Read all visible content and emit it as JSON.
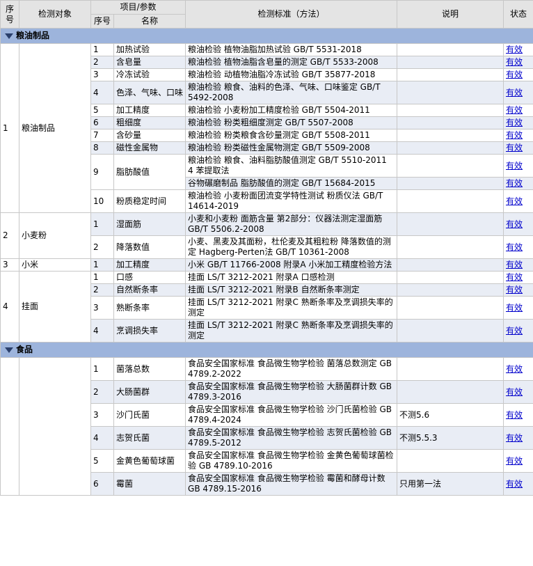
{
  "header": {
    "seq": "序号",
    "object": "检测对象",
    "item_param": "项目/参数",
    "sub_seq": "序号",
    "sub_name": "名称",
    "standard": "检测标准（方法）",
    "note": "说明",
    "status": "状态"
  },
  "categories": [
    {
      "name": "粮油制品",
      "groups": [
        {
          "seq": "1",
          "object": "粮油制品",
          "items": [
            {
              "no": "1",
              "name": "加热试验",
              "standards": [
                "粮油检验 植物油脂加热试验 GB/T 5531-2018"
              ],
              "note": "",
              "status": "有效"
            },
            {
              "no": "2",
              "name": "含皂量",
              "standards": [
                "粮油检验 植物油脂含皂量的测定 GB/T 5533-2008"
              ],
              "note": "",
              "status": "有效"
            },
            {
              "no": "3",
              "name": "冷冻试验",
              "standards": [
                "粮油检验 动植物油脂冷冻试验 GB/T 35877-2018"
              ],
              "note": "",
              "status": "有效"
            },
            {
              "no": "4",
              "name": "色泽、气味、口味",
              "standards": [
                "粮油检验 粮食、油料的色泽、气味、口味鉴定 GB/T 5492-2008"
              ],
              "note": "",
              "status": "有效"
            },
            {
              "no": "5",
              "name": "加工精度",
              "standards": [
                "粮油检验 小麦粉加工精度检验 GB/T 5504-2011"
              ],
              "note": "",
              "status": "有效"
            },
            {
              "no": "6",
              "name": "粗细度",
              "standards": [
                "粮油检验 粉类粗细度测定 GB/T 5507-2008"
              ],
              "note": "",
              "status": "有效"
            },
            {
              "no": "7",
              "name": "含砂量",
              "standards": [
                "粮油检验 粉类粮食含砂量测定 GB/T 5508-2011"
              ],
              "note": "",
              "status": "有效"
            },
            {
              "no": "8",
              "name": "磁性金属物",
              "standards": [
                "粮油检验 粉类磁性金属物测定 GB/T 5509-2008"
              ],
              "note": "",
              "status": "有效"
            },
            {
              "no": "9",
              "name": "脂肪酸值",
              "standards": [
                "粮油检验 粮食、油料脂肪酸值测定 GB/T 5510-2011 4 苯提取法",
                "谷物碾磨制品 脂肪酸值的测定 GB/T 15684-2015"
              ],
              "note": "",
              "status": "有效"
            },
            {
              "no": "10",
              "name": "粉质稳定时间",
              "standards": [
                "粮油检验 小麦粉面团流变学特性测试 粉质仪法 GB/T 14614-2019"
              ],
              "note": "",
              "status": "有效"
            }
          ]
        },
        {
          "seq": "2",
          "object": "小麦粉",
          "items": [
            {
              "no": "1",
              "name": "湿面筋",
              "standards": [
                "小麦和小麦粉 面筋含量 第2部分：仪器法测定湿面筋 GB/T 5506.2-2008"
              ],
              "note": "",
              "status": "有效"
            },
            {
              "no": "2",
              "name": "降落数值",
              "standards": [
                "小麦、黑麦及其面粉，杜伦麦及其粗粒粉 降落数值的测定 Hagberg-Perten法 GB/T 10361-2008"
              ],
              "note": "",
              "status": "有效"
            }
          ]
        },
        {
          "seq": "3",
          "object": "小米",
          "items": [
            {
              "no": "1",
              "name": "加工精度",
              "standards": [
                "小米 GB/T 11766-2008 附录A 小米加工精度检验方法"
              ],
              "note": "",
              "status": "有效"
            }
          ]
        },
        {
          "seq": "4",
          "object": "挂面",
          "items": [
            {
              "no": "1",
              "name": "口感",
              "standards": [
                "挂面 LS/T 3212-2021 附录A 口感检测"
              ],
              "note": "",
              "status": "有效"
            },
            {
              "no": "2",
              "name": "自然断条率",
              "standards": [
                "挂面 LS/T 3212-2021 附录B 自然断条率测定"
              ],
              "note": "",
              "status": "有效"
            },
            {
              "no": "3",
              "name": "熟断条率",
              "standards": [
                "挂面 LS/T 3212-2021 附录C 熟断条率及烹调损失率的测定"
              ],
              "note": "",
              "status": "有效"
            },
            {
              "no": "4",
              "name": "烹调损失率",
              "standards": [
                "挂面 LS/T 3212-2021 附录C 熟断条率及烹调损失率的测定"
              ],
              "note": "",
              "status": "有效"
            }
          ]
        }
      ]
    },
    {
      "name": "食品",
      "groups": [
        {
          "seq": "",
          "object": "",
          "items": [
            {
              "no": "1",
              "name": "菌落总数",
              "standards": [
                "食品安全国家标准 食品微生物学检验 菌落总数测定 GB 4789.2-2022"
              ],
              "note": "",
              "status": "有效"
            },
            {
              "no": "2",
              "name": "大肠菌群",
              "standards": [
                "食品安全国家标准 食品微生物学检验 大肠菌群计数 GB 4789.3-2016"
              ],
              "note": "",
              "status": "有效"
            },
            {
              "no": "3",
              "name": "沙门氏菌",
              "standards": [
                "食品安全国家标准 食品微生物学检验 沙门氏菌检验 GB 4789.4-2024"
              ],
              "note": "不测5.6",
              "status": "有效"
            },
            {
              "no": "4",
              "name": "志贺氏菌",
              "standards": [
                "食品安全国家标准 食品微生物学检验 志贺氏菌检验 GB 4789.5-2012"
              ],
              "note": "不测5.5.3",
              "status": "有效"
            },
            {
              "no": "5",
              "name": "金黄色葡萄球菌",
              "standards": [
                "食品安全国家标准 食品微生物学检验 金黄色葡萄球菌检验 GB 4789.10-2016"
              ],
              "note": "",
              "status": "有效"
            },
            {
              "no": "6",
              "name": "霉菌",
              "standards": [
                "食品安全国家标准 食品微生物学检验 霉菌和酵母计数 GB 4789.15-2016"
              ],
              "note": "只用第一法",
              "status": "有效"
            }
          ]
        }
      ]
    }
  ],
  "colors": {
    "category_bar": "#9db4dc",
    "header_bg": "#e4e4e4",
    "row_alt": "#e9edf5",
    "link": "#0000cc"
  }
}
